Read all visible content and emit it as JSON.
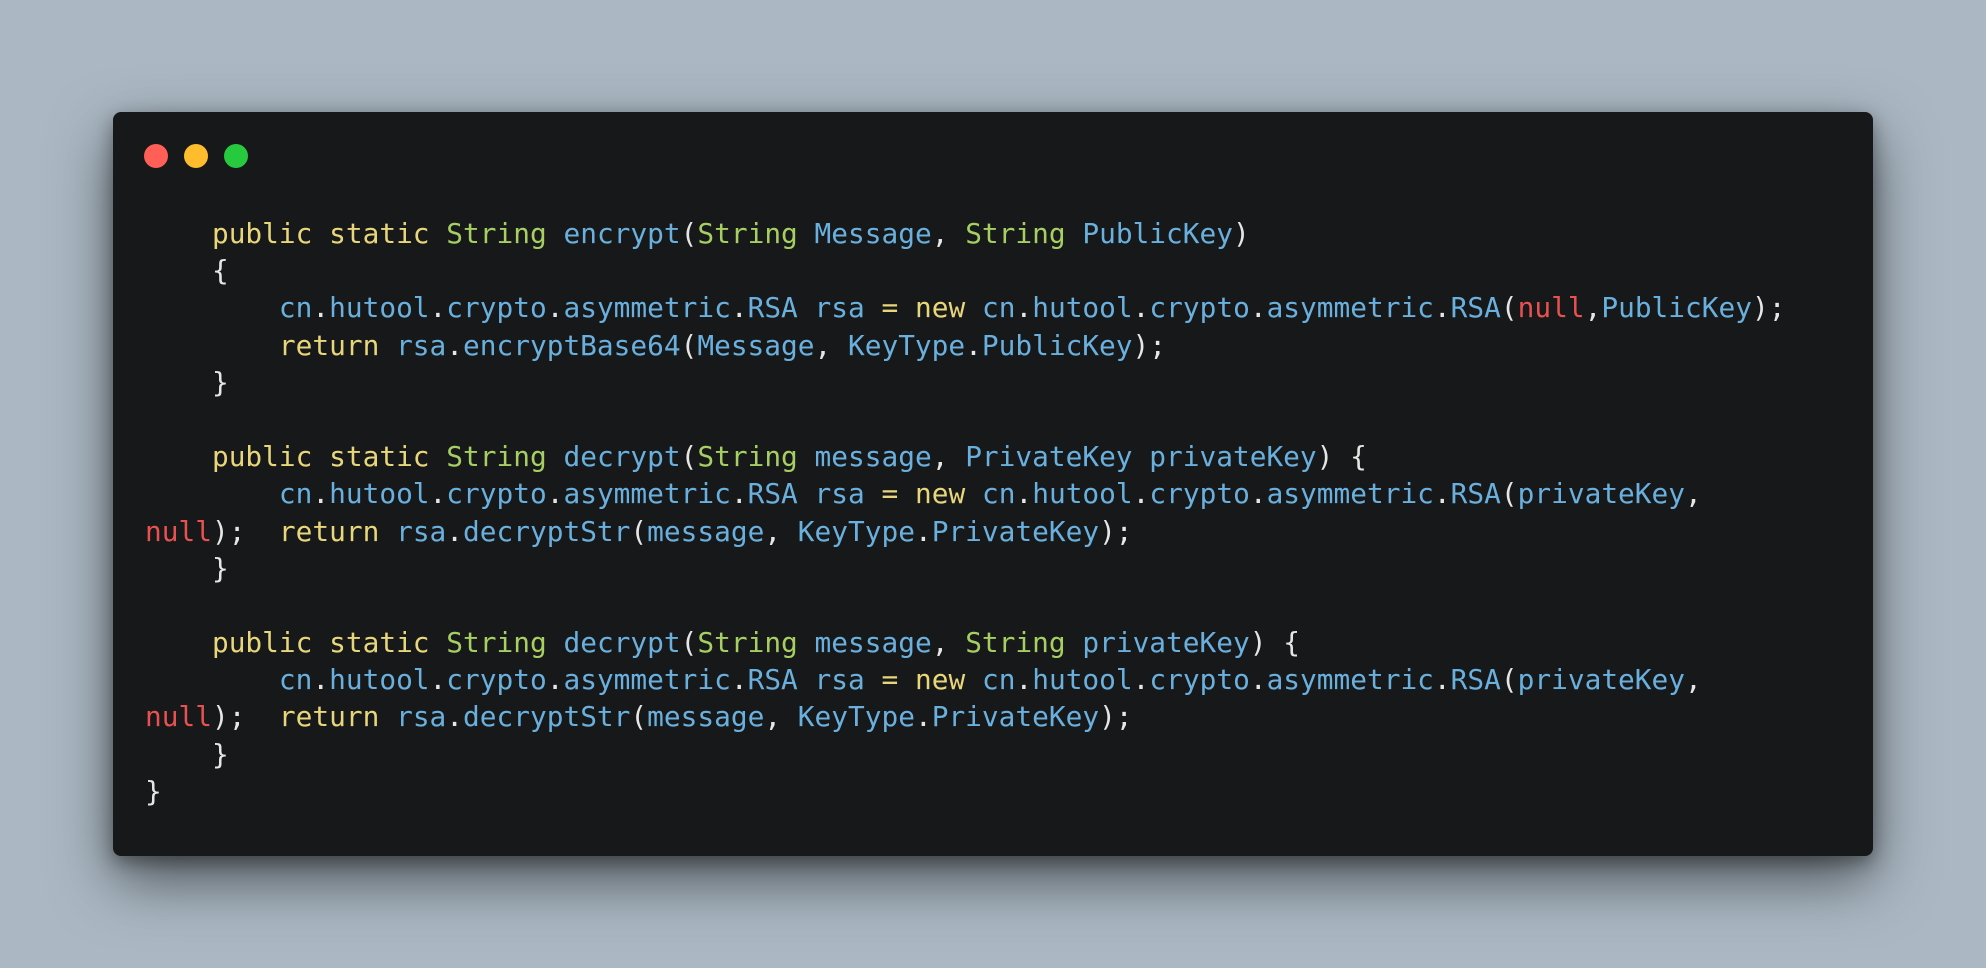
{
  "window": {
    "controls": [
      {
        "name": "close",
        "color": "#ff5f56"
      },
      {
        "name": "minimize",
        "color": "#ffbd2e"
      },
      {
        "name": "maximize",
        "color": "#27c93f"
      }
    ]
  },
  "colors": {
    "background": "#abb8c3",
    "editor": "#171819",
    "keyword": "#e8d67a",
    "type": "#a6cf62",
    "identifier": "#6ab0de",
    "null": "#e8514f",
    "punctuation": "#e6e6e6"
  },
  "code_lines": [
    [
      {
        "t": "    ",
        "k": "punc"
      },
      {
        "t": "public",
        "k": "kw"
      },
      {
        "t": " ",
        "k": "punc"
      },
      {
        "t": "static",
        "k": "kw"
      },
      {
        "t": " ",
        "k": "punc"
      },
      {
        "t": "String",
        "k": "type"
      },
      {
        "t": " ",
        "k": "punc"
      },
      {
        "t": "encrypt",
        "k": "id"
      },
      {
        "t": "(",
        "k": "punc"
      },
      {
        "t": "String",
        "k": "type"
      },
      {
        "t": " ",
        "k": "punc"
      },
      {
        "t": "Message",
        "k": "id"
      },
      {
        "t": ", ",
        "k": "punc"
      },
      {
        "t": "String",
        "k": "type"
      },
      {
        "t": " ",
        "k": "punc"
      },
      {
        "t": "PublicKey",
        "k": "id"
      },
      {
        "t": ")",
        "k": "punc"
      }
    ],
    [
      {
        "t": "    {",
        "k": "punc"
      }
    ],
    [
      {
        "t": "        ",
        "k": "punc"
      },
      {
        "t": "cn",
        "k": "id"
      },
      {
        "t": ".",
        "k": "punc"
      },
      {
        "t": "hutool",
        "k": "id"
      },
      {
        "t": ".",
        "k": "punc"
      },
      {
        "t": "crypto",
        "k": "id"
      },
      {
        "t": ".",
        "k": "punc"
      },
      {
        "t": "asymmetric",
        "k": "id"
      },
      {
        "t": ".",
        "k": "punc"
      },
      {
        "t": "RSA",
        "k": "id"
      },
      {
        "t": " ",
        "k": "punc"
      },
      {
        "t": "rsa",
        "k": "id"
      },
      {
        "t": " ",
        "k": "punc"
      },
      {
        "t": "=",
        "k": "kw"
      },
      {
        "t": " ",
        "k": "punc"
      },
      {
        "t": "new",
        "k": "kw"
      },
      {
        "t": " ",
        "k": "punc"
      },
      {
        "t": "cn",
        "k": "id"
      },
      {
        "t": ".",
        "k": "punc"
      },
      {
        "t": "hutool",
        "k": "id"
      },
      {
        "t": ".",
        "k": "punc"
      },
      {
        "t": "crypto",
        "k": "id"
      },
      {
        "t": ".",
        "k": "punc"
      },
      {
        "t": "asymmetric",
        "k": "id"
      },
      {
        "t": ".",
        "k": "punc"
      },
      {
        "t": "RSA",
        "k": "id"
      },
      {
        "t": "(",
        "k": "punc"
      },
      {
        "t": "null",
        "k": "null"
      },
      {
        "t": ",",
        "k": "punc"
      },
      {
        "t": "PublicKey",
        "k": "id"
      },
      {
        "t": ");",
        "k": "punc"
      }
    ],
    [
      {
        "t": "        ",
        "k": "punc"
      },
      {
        "t": "return",
        "k": "kw"
      },
      {
        "t": " ",
        "k": "punc"
      },
      {
        "t": "rsa",
        "k": "id"
      },
      {
        "t": ".",
        "k": "punc"
      },
      {
        "t": "encryptBase64",
        "k": "id"
      },
      {
        "t": "(",
        "k": "punc"
      },
      {
        "t": "Message",
        "k": "id"
      },
      {
        "t": ", ",
        "k": "punc"
      },
      {
        "t": "KeyType",
        "k": "id"
      },
      {
        "t": ".",
        "k": "punc"
      },
      {
        "t": "PublicKey",
        "k": "id"
      },
      {
        "t": ");",
        "k": "punc"
      }
    ],
    [
      {
        "t": "    }",
        "k": "punc"
      }
    ],
    [],
    [
      {
        "t": "    ",
        "k": "punc"
      },
      {
        "t": "public",
        "k": "kw"
      },
      {
        "t": " ",
        "k": "punc"
      },
      {
        "t": "static",
        "k": "kw"
      },
      {
        "t": " ",
        "k": "punc"
      },
      {
        "t": "String",
        "k": "type"
      },
      {
        "t": " ",
        "k": "punc"
      },
      {
        "t": "decrypt",
        "k": "id"
      },
      {
        "t": "(",
        "k": "punc"
      },
      {
        "t": "String",
        "k": "type"
      },
      {
        "t": " ",
        "k": "punc"
      },
      {
        "t": "message",
        "k": "id"
      },
      {
        "t": ", ",
        "k": "punc"
      },
      {
        "t": "PrivateKey",
        "k": "id"
      },
      {
        "t": " ",
        "k": "punc"
      },
      {
        "t": "privateKey",
        "k": "id"
      },
      {
        "t": ") {",
        "k": "punc"
      }
    ],
    [
      {
        "t": "        ",
        "k": "punc"
      },
      {
        "t": "cn",
        "k": "id"
      },
      {
        "t": ".",
        "k": "punc"
      },
      {
        "t": "hutool",
        "k": "id"
      },
      {
        "t": ".",
        "k": "punc"
      },
      {
        "t": "crypto",
        "k": "id"
      },
      {
        "t": ".",
        "k": "punc"
      },
      {
        "t": "asymmetric",
        "k": "id"
      },
      {
        "t": ".",
        "k": "punc"
      },
      {
        "t": "RSA",
        "k": "id"
      },
      {
        "t": " ",
        "k": "punc"
      },
      {
        "t": "rsa",
        "k": "id"
      },
      {
        "t": " ",
        "k": "punc"
      },
      {
        "t": "=",
        "k": "kw"
      },
      {
        "t": " ",
        "k": "punc"
      },
      {
        "t": "new",
        "k": "kw"
      },
      {
        "t": " ",
        "k": "punc"
      },
      {
        "t": "cn",
        "k": "id"
      },
      {
        "t": ".",
        "k": "punc"
      },
      {
        "t": "hutool",
        "k": "id"
      },
      {
        "t": ".",
        "k": "punc"
      },
      {
        "t": "crypto",
        "k": "id"
      },
      {
        "t": ".",
        "k": "punc"
      },
      {
        "t": "asymmetric",
        "k": "id"
      },
      {
        "t": ".",
        "k": "punc"
      },
      {
        "t": "RSA",
        "k": "id"
      },
      {
        "t": "(",
        "k": "punc"
      },
      {
        "t": "privateKey",
        "k": "id"
      },
      {
        "t": ",",
        "k": "punc"
      }
    ],
    [
      {
        "t": "null",
        "k": "null"
      },
      {
        "t": ");  ",
        "k": "punc"
      },
      {
        "t": "return",
        "k": "kw"
      },
      {
        "t": " ",
        "k": "punc"
      },
      {
        "t": "rsa",
        "k": "id"
      },
      {
        "t": ".",
        "k": "punc"
      },
      {
        "t": "decryptStr",
        "k": "id"
      },
      {
        "t": "(",
        "k": "punc"
      },
      {
        "t": "message",
        "k": "id"
      },
      {
        "t": ", ",
        "k": "punc"
      },
      {
        "t": "KeyType",
        "k": "id"
      },
      {
        "t": ".",
        "k": "punc"
      },
      {
        "t": "PrivateKey",
        "k": "id"
      },
      {
        "t": ");",
        "k": "punc"
      }
    ],
    [
      {
        "t": "    }",
        "k": "punc"
      }
    ],
    [],
    [
      {
        "t": "    ",
        "k": "punc"
      },
      {
        "t": "public",
        "k": "kw"
      },
      {
        "t": " ",
        "k": "punc"
      },
      {
        "t": "static",
        "k": "kw"
      },
      {
        "t": " ",
        "k": "punc"
      },
      {
        "t": "String",
        "k": "type"
      },
      {
        "t": " ",
        "k": "punc"
      },
      {
        "t": "decrypt",
        "k": "id"
      },
      {
        "t": "(",
        "k": "punc"
      },
      {
        "t": "String",
        "k": "type"
      },
      {
        "t": " ",
        "k": "punc"
      },
      {
        "t": "message",
        "k": "id"
      },
      {
        "t": ", ",
        "k": "punc"
      },
      {
        "t": "String",
        "k": "type"
      },
      {
        "t": " ",
        "k": "punc"
      },
      {
        "t": "privateKey",
        "k": "id"
      },
      {
        "t": ") {",
        "k": "punc"
      }
    ],
    [
      {
        "t": "        ",
        "k": "punc"
      },
      {
        "t": "cn",
        "k": "id"
      },
      {
        "t": ".",
        "k": "punc"
      },
      {
        "t": "hutool",
        "k": "id"
      },
      {
        "t": ".",
        "k": "punc"
      },
      {
        "t": "crypto",
        "k": "id"
      },
      {
        "t": ".",
        "k": "punc"
      },
      {
        "t": "asymmetric",
        "k": "id"
      },
      {
        "t": ".",
        "k": "punc"
      },
      {
        "t": "RSA",
        "k": "id"
      },
      {
        "t": " ",
        "k": "punc"
      },
      {
        "t": "rsa",
        "k": "id"
      },
      {
        "t": " ",
        "k": "punc"
      },
      {
        "t": "=",
        "k": "kw"
      },
      {
        "t": " ",
        "k": "punc"
      },
      {
        "t": "new",
        "k": "kw"
      },
      {
        "t": " ",
        "k": "punc"
      },
      {
        "t": "cn",
        "k": "id"
      },
      {
        "t": ".",
        "k": "punc"
      },
      {
        "t": "hutool",
        "k": "id"
      },
      {
        "t": ".",
        "k": "punc"
      },
      {
        "t": "crypto",
        "k": "id"
      },
      {
        "t": ".",
        "k": "punc"
      },
      {
        "t": "asymmetric",
        "k": "id"
      },
      {
        "t": ".",
        "k": "punc"
      },
      {
        "t": "RSA",
        "k": "id"
      },
      {
        "t": "(",
        "k": "punc"
      },
      {
        "t": "privateKey",
        "k": "id"
      },
      {
        "t": ",",
        "k": "punc"
      }
    ],
    [
      {
        "t": "null",
        "k": "null"
      },
      {
        "t": ");  ",
        "k": "punc"
      },
      {
        "t": "return",
        "k": "kw"
      },
      {
        "t": " ",
        "k": "punc"
      },
      {
        "t": "rsa",
        "k": "id"
      },
      {
        "t": ".",
        "k": "punc"
      },
      {
        "t": "decryptStr",
        "k": "id"
      },
      {
        "t": "(",
        "k": "punc"
      },
      {
        "t": "message",
        "k": "id"
      },
      {
        "t": ", ",
        "k": "punc"
      },
      {
        "t": "KeyType",
        "k": "id"
      },
      {
        "t": ".",
        "k": "punc"
      },
      {
        "t": "PrivateKey",
        "k": "id"
      },
      {
        "t": ");",
        "k": "punc"
      }
    ],
    [
      {
        "t": "    }",
        "k": "punc"
      }
    ],
    [
      {
        "t": "}",
        "k": "punc"
      }
    ]
  ]
}
